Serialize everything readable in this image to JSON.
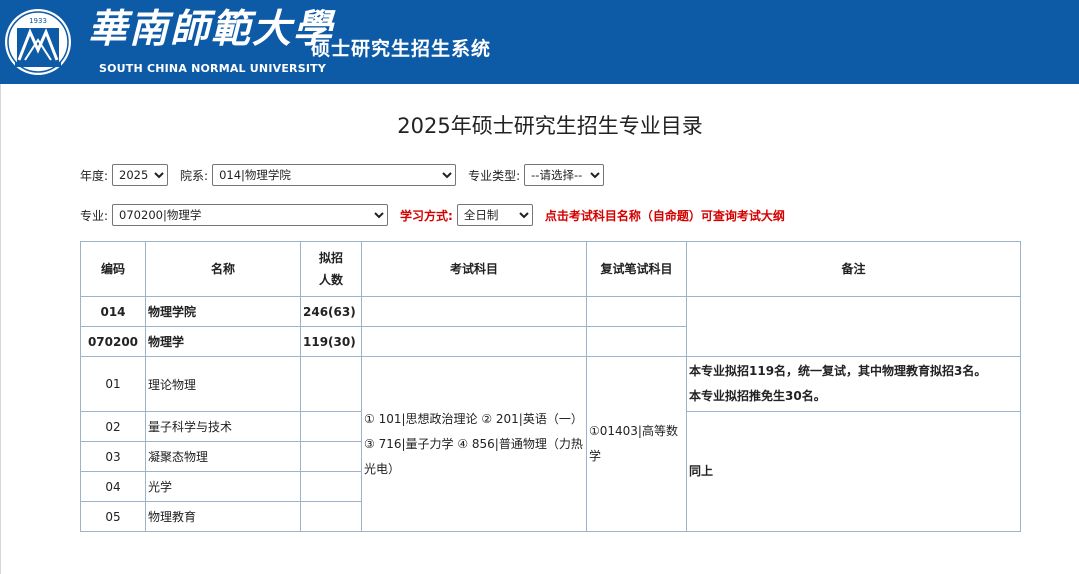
{
  "header": {
    "logo_year": "1933",
    "school_name_cn": "華南師範大學",
    "system_name": "硕士研究生招生系统",
    "school_name_en": "SOUTH CHINA NORMAL UNIVERSITY"
  },
  "page_title": "2025年硕士研究生招生专业目录",
  "filters": {
    "year_label": "年度:",
    "year_value": "2025",
    "college_label": "院系:",
    "college_value": "014|物理学院",
    "major_type_label": "专业类型:",
    "major_type_value": "--请选择--",
    "major_label": "专业:",
    "major_value": "070200|物理学",
    "study_mode_label": "学习方式:",
    "study_mode_value": "全日制",
    "hint": "点击考试科目名称（自命题）可查询考试大纲"
  },
  "table": {
    "headers": {
      "code": "编码",
      "name": "名称",
      "quota_line1": "拟招",
      "quota_line2": "人数",
      "exam": "考试科目",
      "retest": "复试笔试科目",
      "remark": "备注"
    },
    "college_row": {
      "code": "014",
      "name": "物理学院",
      "quota": "246(63)"
    },
    "major_row": {
      "code": "070200",
      "name": "物理学",
      "quota": "119(30)"
    },
    "directions": [
      {
        "code": "01",
        "name": "理论物理"
      },
      {
        "code": "02",
        "name": "量子科学与技术"
      },
      {
        "code": "03",
        "name": "凝聚态物理"
      },
      {
        "code": "04",
        "name": "光学"
      },
      {
        "code": "05",
        "name": "物理教育"
      }
    ],
    "exam_subjects": "① 101|思想政治理论 ② 201|英语（一） ③ 716|量子力学 ④ 856|普通物理（力热光电）",
    "retest_subject": "①01403|高等数学",
    "remark_first_line1": "本专业拟招119名，统一复试，其中物理教育拟招3名。",
    "remark_first_line2": "本专业拟招推免生30名。",
    "remark_rest": "同上"
  },
  "colors": {
    "header_bg": "#0d5aa7",
    "hint": "#d40000",
    "border": "#9fb3c8"
  }
}
